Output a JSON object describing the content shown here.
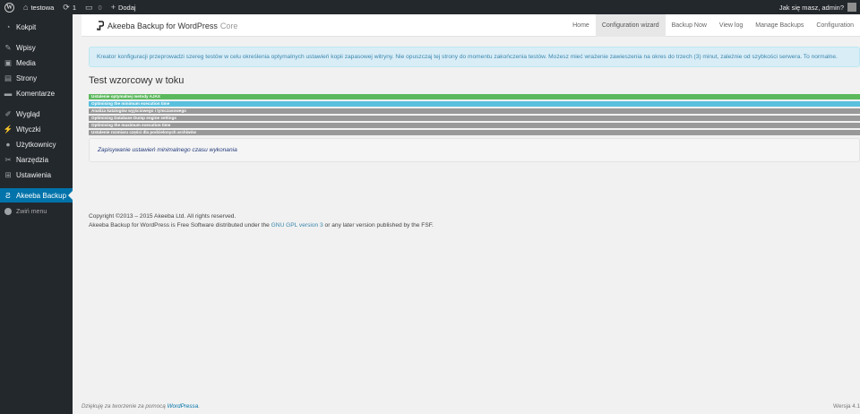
{
  "adminbar": {
    "site_name": "testowa",
    "updates_count": "1",
    "comments_count": "0",
    "new_label": "Dodaj",
    "greeting": "Jak się masz, admin?"
  },
  "sidebar": {
    "items": [
      {
        "label": "Kokpit",
        "icon": "dashboard-icon"
      },
      {
        "label": "Wpisy",
        "icon": "pin-icon"
      },
      {
        "label": "Media",
        "icon": "media-icon"
      },
      {
        "label": "Strony",
        "icon": "pages-icon"
      },
      {
        "label": "Komentarze",
        "icon": "comments-icon"
      },
      {
        "label": "Wygląd",
        "icon": "appearance-icon"
      },
      {
        "label": "Wtyczki",
        "icon": "plugins-icon"
      },
      {
        "label": "Użytkownicy",
        "icon": "users-icon"
      },
      {
        "label": "Narzędzia",
        "icon": "tools-icon"
      },
      {
        "label": "Ustawienia",
        "icon": "settings-icon"
      },
      {
        "label": "Akeeba Backup",
        "icon": "akeeba-icon"
      }
    ],
    "collapse_label": "Zwiń menu"
  },
  "akeeba": {
    "brand": "Akeeba Backup for WordPress",
    "edition": "Core",
    "nav": [
      "Home",
      "Configuration wizard",
      "Backup Now",
      "View log",
      "Manage Backups",
      "Configuration"
    ],
    "active_nav": "Configuration wizard"
  },
  "alert": {
    "text": "Kreator konfiguracji przeprowadzi szereg testów w celu określenia optymalnych ustawień kopii zapasowej witryny. Nie opuszczaj tej strony do momentu zakończenia testów. Możesz mieć wrażenie zawieszenia na okres do trzech (3) minut, zależnie od szybkości serwera. To normalne."
  },
  "page_title": "Test wzorcowy w toku",
  "steps": [
    {
      "label": "Ustalenie optymalnej metody AJAX",
      "status": "done"
    },
    {
      "label": "Optimising the minimum execution time",
      "status": "running"
    },
    {
      "label": "Analiza katalogów wyjściowego i tymczasowego",
      "status": "pending"
    },
    {
      "label": "Optimising Database Dump engine settings",
      "status": "pending"
    },
    {
      "label": "Optimising the maximum execution time",
      "status": "pending"
    },
    {
      "label": "Ustalenie rozmiaru części dla podzielonych archiwów",
      "status": "pending"
    }
  ],
  "status_message": "Zapisywanie ustawień minimalnego czasu wykonania",
  "footer": {
    "copyright": "Copyright ©2013 – 2015 Akeeba Ltd. All rights reserved.",
    "license_prefix": "Akeeba Backup for WordPress is Free Software distributed under the",
    "license_link": "GNU GPL version 3",
    "license_suffix": "or any later version published by the FSF.",
    "thanks_prefix": "Dziękuję za tworzenie za pomocą",
    "thanks_link": "WordPressa",
    "version": "Wersja 4.1"
  },
  "colors": {
    "step_done": "#5cb85c",
    "step_running": "#5bc0de",
    "step_pending": "#999999",
    "sidebar_active": "#0073aa"
  }
}
